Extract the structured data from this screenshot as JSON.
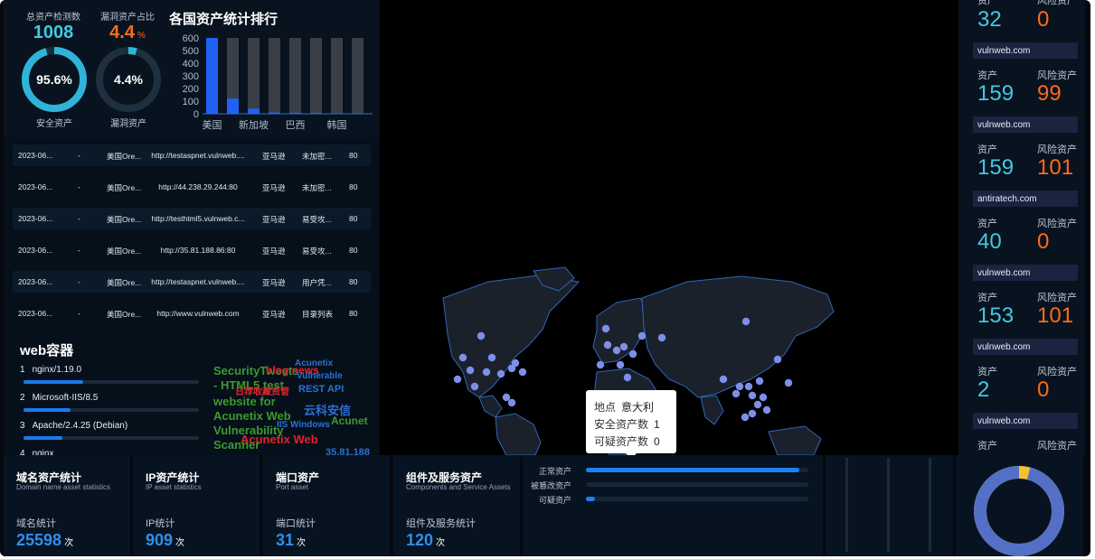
{
  "top_stats": {
    "total_label": "总资产检测数",
    "total_value": "1008",
    "vuln_label": "漏洞资产占比",
    "vuln_value": "4.4",
    "vuln_unit": "%",
    "safe_ring_value": "95.6%",
    "safe_ring_label": "安全资产",
    "vuln_ring_value": "4.4%",
    "vuln_ring_label": "漏洞资产",
    "safe_fraction": 0.956,
    "vuln_fraction": 0.044
  },
  "chart_data": {
    "type": "bar",
    "title": "各国资产统计排行",
    "categories": [
      "美国",
      "",
      "新加坡",
      "",
      "巴西",
      "",
      "韩国",
      ""
    ],
    "x_tick_labels": [
      "美国",
      "新加坡",
      "巴西",
      "韩国"
    ],
    "values": [
      600,
      120,
      40,
      10,
      8,
      6,
      4,
      3
    ],
    "background_value": 600,
    "ylim": [
      0,
      600
    ],
    "y_ticks": [
      "600",
      "500",
      "400",
      "300",
      "200",
      "100",
      "0"
    ]
  },
  "table": {
    "rows": [
      [
        "2023-06...",
        "-",
        "美国Ore...",
        "http://testaspnet.vulnweb....",
        "亚马逊",
        "未加密...",
        "80"
      ],
      [
        "2023-06...",
        "-",
        "美国Ore...",
        "http://44.238.29.244:80",
        "亚马逊",
        "未加密...",
        "80"
      ],
      [
        "2023-06...",
        "-",
        "美国Ore...",
        "http://testhtml5.vulnweb.c...",
        "亚马逊",
        "易受攻...",
        "80"
      ],
      [
        "2023-06...",
        "-",
        "美国Ore...",
        "http://35.81.188.86:80",
        "亚马逊",
        "易受攻...",
        "80"
      ],
      [
        "2023-06...",
        "-",
        "美国Ore...",
        "http://testaspnet.vulnweb....",
        "亚马逊",
        "用户凭...",
        "80"
      ],
      [
        "2023-06...",
        "-",
        "美国Ore...",
        "http://www.vulnweb.com",
        "亚马逊",
        "目录列表",
        "80"
      ]
    ]
  },
  "web_container": {
    "title": "web容器",
    "items": [
      {
        "rank": "1",
        "name": "nginx/1.19.0",
        "fraction": 0.34
      },
      {
        "rank": "2",
        "name": "Microsoft-IIS/8.5",
        "fraction": 0.27
      },
      {
        "rank": "3",
        "name": "Apache/2.4.25 (Debian)",
        "fraction": 0.22
      },
      {
        "rank": "4",
        "name": "nginx",
        "fraction": 0.1
      }
    ]
  },
  "word_cloud": [
    {
      "text": "SecurityTweets",
      "color": "#3c9a2e"
    },
    {
      "text": "blog news",
      "color": "#e0242c"
    },
    {
      "text": "Acunetix",
      "color": "#2b6fd4"
    },
    {
      "text": "Vulnerable",
      "color": "#2b6fd4"
    },
    {
      "text": "- HTML5 test",
      "color": "#3c9a2e"
    },
    {
      "text": "日荐收藏资管",
      "color": "#e0242c"
    },
    {
      "text": "REST API",
      "color": "#2b6fd4"
    },
    {
      "text": "website for",
      "color": "#3c9a2e"
    },
    {
      "text": "云科安信",
      "color": "#2b6fd4"
    },
    {
      "text": "Acunetix Web",
      "color": "#3c9a2e"
    },
    {
      "text": "IIS Windows",
      "color": "#2b6fd4"
    },
    {
      "text": "Acunet",
      "color": "#3c9a2e"
    },
    {
      "text": "Vulnerability",
      "color": "#3c9a2e"
    },
    {
      "text": "Acunetix Web",
      "color": "#e0242c"
    },
    {
      "text": "Scanner",
      "color": "#3c9a2e"
    },
    {
      "text": "35.81.188",
      "color": "#2b6fd4"
    }
  ],
  "map_tooltip": {
    "location_label": "地点",
    "location_value": "意大利",
    "safe_label": "安全资产数",
    "safe_value": "1",
    "suspect_label": "可疑资产数",
    "suspect_value": "0"
  },
  "right_panel": {
    "asset_label": "资产",
    "risk_label": "风险资产",
    "top_partial": {
      "assets": "32",
      "risk": "0"
    },
    "sites": [
      {
        "domain": "vulnweb.com",
        "assets": "159",
        "risk": "99"
      },
      {
        "domain": "vulnweb.com",
        "assets": "159",
        "risk": "101"
      },
      {
        "domain": "antiratech.com",
        "assets": "40",
        "risk": "0"
      },
      {
        "domain": "vulnweb.com",
        "assets": "153",
        "risk": "101"
      },
      {
        "domain": "vulnweb.com",
        "assets": "2",
        "risk": "0"
      },
      {
        "domain": "vulnweb.com",
        "assets": "",
        "risk": ""
      }
    ]
  },
  "bottom_cards": [
    {
      "title": "域名资产统计",
      "subtitle": "Domain name asset statistics",
      "label": "域名统计",
      "value": "25598",
      "unit": "次"
    },
    {
      "title": "IP资产统计",
      "subtitle": "IP asset statistics",
      "label": "IP统计",
      "value": "909",
      "unit": "次"
    },
    {
      "title": "端口资产",
      "subtitle": "Port asset",
      "label": "端口统计",
      "value": "31",
      "unit": "次"
    },
    {
      "title": "组件及服务资产",
      "subtitle": "Components and Service Assets",
      "label": "组件及服务统计",
      "value": "120",
      "unit": "次"
    }
  ],
  "status_bars": [
    {
      "label": "正常资产",
      "fraction": 0.96
    },
    {
      "label": "被篡改资产",
      "fraction": 0.0
    },
    {
      "label": "可疑资产",
      "fraction": 0.04
    }
  ],
  "donut": {
    "main_fraction": 0.96,
    "main_color": "#5470c6",
    "minor_color": "#f2c230"
  },
  "colors": {
    "accent_blue": "#2f8ff0",
    "accent_orange": "#ff6a1a",
    "teal": "#45c8e0"
  }
}
